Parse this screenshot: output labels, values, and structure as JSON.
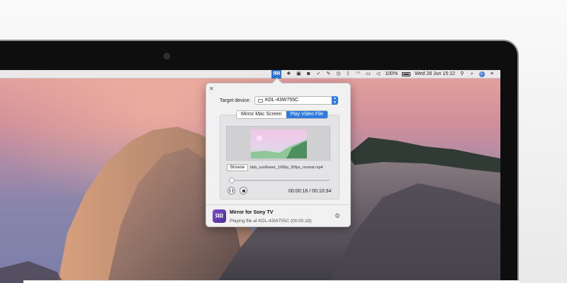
{
  "menubar": {
    "app_icon_label": "ЯR",
    "icons": [
      "dropbox-icon",
      "app-icon-2",
      "app-icon-3",
      "check-icon",
      "evernote-icon",
      "time-machine-icon",
      "bluetooth-icon",
      "wifi-icon",
      "airplay-icon",
      "volume-icon"
    ],
    "battery_text": "100%",
    "clock": "Wed 28 Jun  15:12"
  },
  "popover": {
    "target_label": "Target device:",
    "device_value": "KDL-43W755C",
    "tabs": [
      {
        "label": "Mirror Mac Screen",
        "active": false
      },
      {
        "label": "Play Video File",
        "active": true
      }
    ],
    "browse_label": "Browse",
    "file_name": "bbb_sunflower_1080p_30fps_normal.mp4",
    "progress_fraction": 0.0295,
    "time_text": "00:00:18 / 00:10:34",
    "app_name": "Mirror for Sony TV",
    "status_text": "Playing file at KDL-43W755C (00:00:18)",
    "app_icon_label": "ЯR"
  },
  "colors": {
    "accent": "#2f7ae0",
    "app_icon": "#5b36a8"
  }
}
